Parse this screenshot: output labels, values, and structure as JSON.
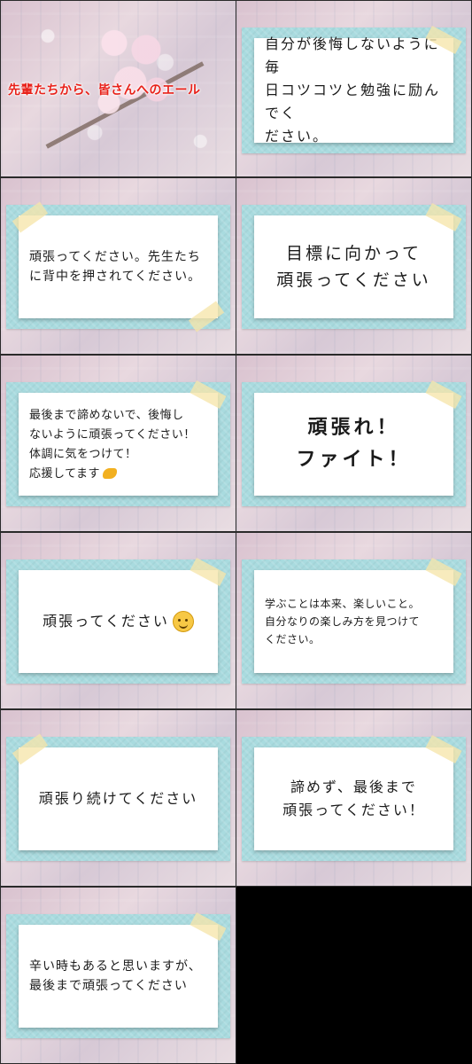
{
  "title": "先輩たちから、皆さんへのエール",
  "messages": [
    "自分が後悔しないように毎\n日コツコツと勉強に励んでく\nださい。",
    "頑張ってください。先生たち\nに背中を押されてください。",
    "目標に向かって\n頑張ってください",
    "最後まで諦めないで、後悔し\nないように頑張ってください！\n体調に気をつけて！\n応援してます",
    "頑張れ！\nファイト！",
    "頑張ってください",
    "学ぶことは本来、楽しいこと。\n自分なりの楽しみ方を見つけて\nください。",
    "頑張り続けてください",
    "諦めず、最後まで\n頑張ってください！",
    "辛い時もあると思いますが、\n最後まで頑張ってください"
  ],
  "icons": {
    "smile": "smiling-face-emoji-icon",
    "flex": "flexed-biceps-emoji-icon"
  },
  "colors": {
    "title": "#e8211a",
    "card_frame": "#a9dbdf",
    "paper": "#ffffff",
    "tape": "#f6e6aa"
  }
}
